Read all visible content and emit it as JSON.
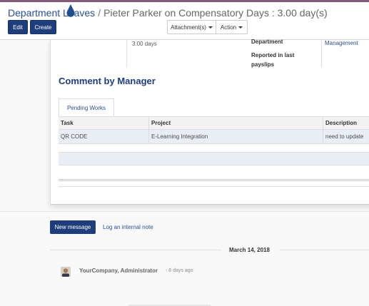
{
  "breadcrumb": {
    "parent": "Department Leaves",
    "separator": "/",
    "current": "Pieter Parker on Compensatory Days : 3.00 day(s)"
  },
  "buttons": {
    "edit": "Edit",
    "create": "Create",
    "attachments": "Attachment(s)",
    "action": "Action"
  },
  "form": {
    "duration_value": "3.00 days",
    "department_label": "Department",
    "department_value": "Management",
    "reported_label": "Reported in last payslips"
  },
  "section": {
    "title": "Comment by Manager",
    "tab": "Pending Works"
  },
  "grid": {
    "columns": [
      "Task",
      "Project",
      "Description"
    ],
    "rows": [
      {
        "task": "QR CODE",
        "project": "E-Learning Integration",
        "description": "need to update"
      }
    ]
  },
  "chatter": {
    "new_message": "New message",
    "log_note": "Log an internal note",
    "date": "March 14, 2018",
    "author": "YourCompany, Administrator",
    "ago": "- 6 days ago"
  },
  "colors": {
    "primary": "#1f3d7a",
    "link": "#2a4f8f",
    "brand": "#875a7b",
    "cursor": "#1f4f8f"
  }
}
